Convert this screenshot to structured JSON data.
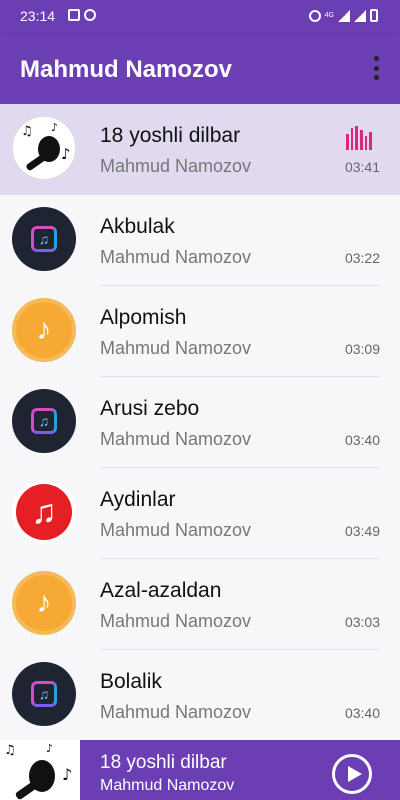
{
  "status_bar": {
    "time": "23:14",
    "network": "4G"
  },
  "app_bar": {
    "title": "Mahmud Namozov",
    "menu_icon": "more-vert-icon"
  },
  "songs": [
    {
      "title": "18 yoshli dilbar",
      "artist": "Mahmud Namozov",
      "duration": "03:41",
      "cover": "microphone",
      "playing": true
    },
    {
      "title": "Akbulak",
      "artist": "Mahmud Namozov",
      "duration": "03:22",
      "cover": "dark-note"
    },
    {
      "title": "Alpomish",
      "artist": "Mahmud Namozov",
      "duration": "03:09",
      "cover": "orange-note"
    },
    {
      "title": "Arusi zebo",
      "artist": "Mahmud Namozov",
      "duration": "03:40",
      "cover": "dark-note"
    },
    {
      "title": "Aydinlar",
      "artist": "Mahmud Namozov",
      "duration": "03:49",
      "cover": "red-note"
    },
    {
      "title": "Azal-azaldan",
      "artist": "Mahmud Namozov",
      "duration": "03:03",
      "cover": "orange-note"
    },
    {
      "title": "Bolalik",
      "artist": "Mahmud Namozov",
      "duration": "03:40",
      "cover": "dark-note"
    }
  ],
  "now_playing": {
    "title": "18 yoshli dilbar",
    "artist": "Mahmud Namozov",
    "button_icon": "play-circle-icon"
  },
  "colors": {
    "primary": "#6b3fb3",
    "active_row": "#e0d9f0",
    "equalizer": "#e2247a"
  }
}
